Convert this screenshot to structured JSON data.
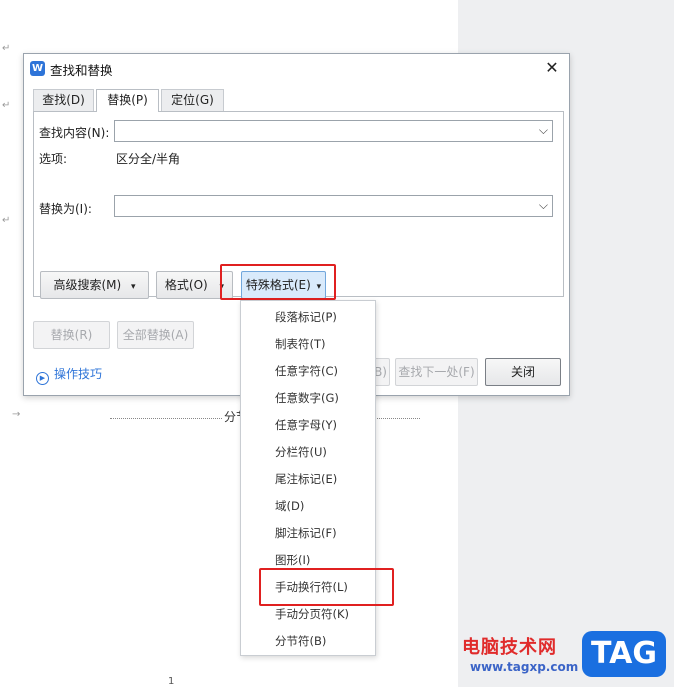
{
  "dialog": {
    "app_logo": "W",
    "title": "查找和替换",
    "close_glyph": "✕"
  },
  "tabs": [
    {
      "label": "查找(D)"
    },
    {
      "label": "替换(P)"
    },
    {
      "label": "定位(G)"
    }
  ],
  "form": {
    "find_label": "查找内容(N):",
    "find_value": "",
    "options_label": "选项:",
    "options_value": "区分全/半角",
    "replace_label": "替换为(I):",
    "replace_value": ""
  },
  "buttons": {
    "advanced": "高级搜索(M)",
    "advanced_glyph": "▾",
    "format": "格式(O)",
    "format_glyph": "▾",
    "special": "特殊格式(E)",
    "special_glyph": "▾",
    "replace": "替换(R)",
    "replace_all": "全部替换(A)",
    "find_prev_partial": "(B)",
    "find_next": "查找下一处(F)",
    "close": "关闭"
  },
  "tips": {
    "label": "操作技巧"
  },
  "special_menu": [
    "段落标记(P)",
    "制表符(T)",
    "任意字符(C)",
    "任意数字(G)",
    "任意字母(Y)",
    "分栏符(U)",
    "尾注标记(E)",
    "域(D)",
    "脚注标记(F)",
    "图形(I)",
    "手动换行符(L)",
    "手动分页符(K)",
    "分节符(B)"
  ],
  "document": {
    "section_break": "分节",
    "page_number": "1"
  },
  "watermark": {
    "site_name": "电脑技术网",
    "url": "www.tagxp.com",
    "tag": "TAG"
  },
  "colors": {
    "highlight_box": "#e02020",
    "accent": "#2e74d8"
  }
}
